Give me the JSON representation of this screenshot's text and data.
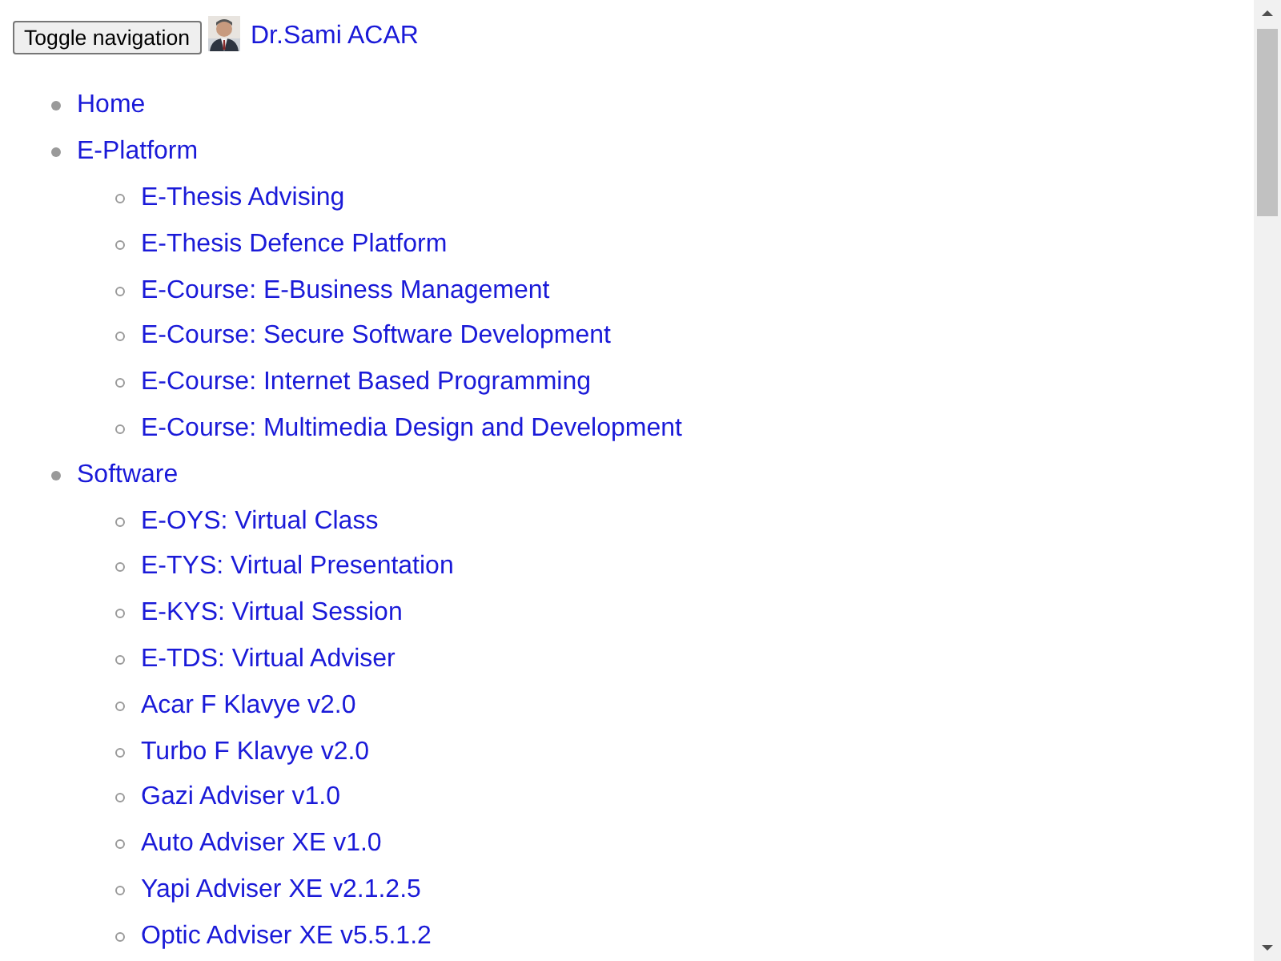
{
  "header": {
    "toggle_button": "Toggle navigation",
    "brand": "Dr.Sami ACAR"
  },
  "menu": [
    {
      "label": "Home"
    },
    {
      "label": "E-Platform",
      "children": [
        {
          "label": "E-Thesis Advising"
        },
        {
          "label": "E-Thesis Defence Platform"
        },
        {
          "label": "E-Course: E-Business Management"
        },
        {
          "label": "E-Course: Secure Software Development"
        },
        {
          "label": "E-Course: Internet Based Programming"
        },
        {
          "label": "E-Course: Multimedia Design and Development"
        }
      ]
    },
    {
      "label": "Software",
      "children": [
        {
          "label": "E-OYS: Virtual Class"
        },
        {
          "label": "E-TYS: Virtual Presentation"
        },
        {
          "label": "E-KYS: Virtual Session"
        },
        {
          "label": "E-TDS: Virtual Adviser"
        },
        {
          "label": "Acar F Klavye v2.0"
        },
        {
          "label": "Turbo F Klavye v2.0"
        },
        {
          "label": "Gazi Adviser v1.0"
        },
        {
          "label": "Auto Adviser XE v1.0"
        },
        {
          "label": "Yapi Adviser XE v2.1.2.5"
        },
        {
          "label": "Optic Adviser XE v5.5.1.2"
        }
      ]
    }
  ]
}
